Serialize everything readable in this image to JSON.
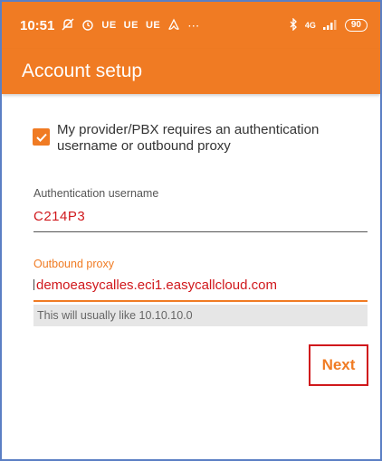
{
  "status_bar": {
    "time": "10:51",
    "indicators": [
      "UE",
      "UE",
      "UE"
    ],
    "network_label": "4G",
    "battery": "90",
    "icons": [
      "mute-icon",
      "alarm-icon",
      "airbnb-icon",
      "more-dots-icon",
      "bluetooth-icon",
      "signal-icon"
    ]
  },
  "app_bar": {
    "title": "Account setup",
    "background_color": "#f07b23"
  },
  "checkbox": {
    "checked": true,
    "label": "My provider/PBX requires an authentication username or outbound proxy"
  },
  "auth_field": {
    "label": "Authentication username",
    "value": "C214P3"
  },
  "proxy_field": {
    "label": "Outbound proxy",
    "value": "demoeasycalles.eci1.easycallcloud.com",
    "hint": "This will usually like 10.10.10.0"
  },
  "next_button": {
    "label": "Next"
  },
  "colors": {
    "accent": "#f07b23",
    "annotation_red": "#d0181c"
  }
}
